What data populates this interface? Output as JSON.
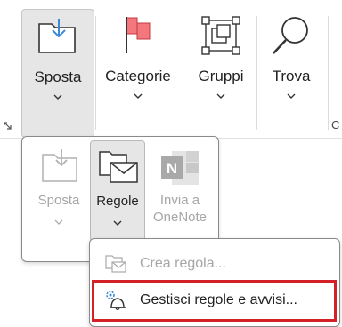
{
  "ribbon": {
    "buttons": [
      {
        "label": "Sposta"
      },
      {
        "label": "Categorie"
      },
      {
        "label": "Gruppi"
      },
      {
        "label": "Trova"
      }
    ],
    "cut_label": "C"
  },
  "sposta_popup": {
    "buttons": [
      {
        "label": "Sposta",
        "enabled": false
      },
      {
        "label": "Regole",
        "enabled": true
      },
      {
        "label": "Invia a OneNote",
        "line1": "Invia a",
        "line2": "OneNote",
        "enabled": false
      }
    ]
  },
  "regole_menu": {
    "items": [
      {
        "label": "Crea regola...",
        "enabled": false
      },
      {
        "label": "Gestisci regole e avvisi...",
        "enabled": true
      }
    ]
  },
  "colors": {
    "highlight_border": "#d42027",
    "flag_red": "#f3777d",
    "folder_blue": "#3a8ad6"
  }
}
